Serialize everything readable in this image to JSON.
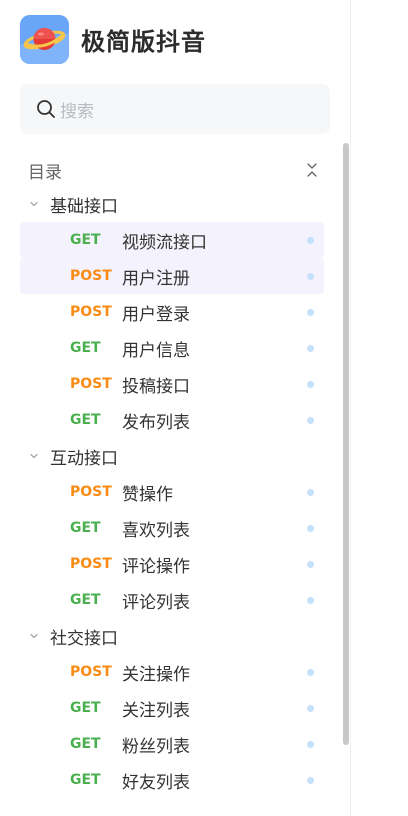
{
  "app": {
    "title": "极简版抖音",
    "logo": "planet-logo-icon"
  },
  "search": {
    "placeholder": "搜索"
  },
  "toc": {
    "title": "目录"
  },
  "groups": [
    {
      "label": "基础接口",
      "items": [
        {
          "method": "GET",
          "label": "视频流接口",
          "selected": true
        },
        {
          "method": "POST",
          "label": "用户注册",
          "selected": true
        },
        {
          "method": "POST",
          "label": "用户登录"
        },
        {
          "method": "GET",
          "label": "用户信息"
        },
        {
          "method": "POST",
          "label": "投稿接口"
        },
        {
          "method": "GET",
          "label": "发布列表"
        }
      ]
    },
    {
      "label": "互动接口",
      "items": [
        {
          "method": "POST",
          "label": "赞操作"
        },
        {
          "method": "GET",
          "label": "喜欢列表"
        },
        {
          "method": "POST",
          "label": "评论操作"
        },
        {
          "method": "GET",
          "label": "评论列表"
        }
      ]
    },
    {
      "label": "社交接口",
      "items": [
        {
          "method": "POST",
          "label": "关注操作"
        },
        {
          "method": "GET",
          "label": "关注列表"
        },
        {
          "method": "GET",
          "label": "粉丝列表"
        },
        {
          "method": "GET",
          "label": "好友列表"
        }
      ]
    }
  ],
  "colors": {
    "get": "#4caf50",
    "post": "#fa8c16",
    "selected_bg": "#f4f2fc",
    "logo_bg": "#6aa6f8"
  }
}
